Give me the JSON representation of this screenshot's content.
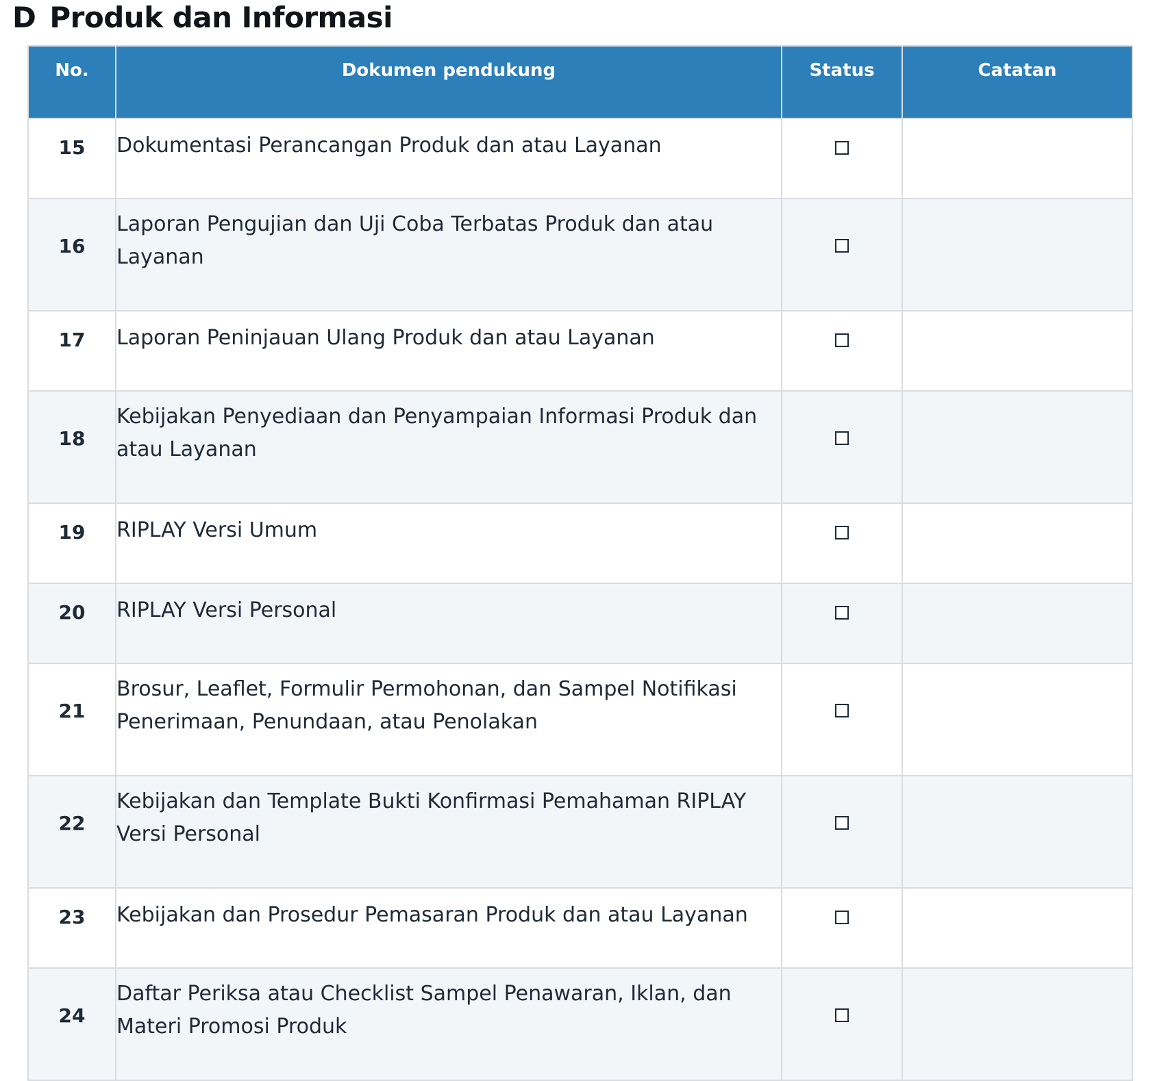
{
  "section": {
    "letter": "D",
    "title": "Produk dan Informasi"
  },
  "table": {
    "headers": {
      "no": "No.",
      "document": "Dokumen pendukung",
      "status": "Status",
      "notes": "Catatan"
    },
    "rows": [
      {
        "no": "15",
        "document": "Dokumentasi Perancangan Produk dan atau Layanan",
        "checked": false,
        "notes": ""
      },
      {
        "no": "16",
        "document": "Laporan Pengujian dan Uji Coba Terbatas Produk dan atau Layanan",
        "checked": false,
        "notes": ""
      },
      {
        "no": "17",
        "document": "Laporan Peninjauan Ulang Produk dan atau Layanan",
        "checked": false,
        "notes": ""
      },
      {
        "no": "18",
        "document": "Kebijakan Penyediaan dan Penyampaian Informasi Produk dan atau Layanan",
        "checked": false,
        "notes": ""
      },
      {
        "no": "19",
        "document": "RIPLAY Versi Umum",
        "checked": false,
        "notes": ""
      },
      {
        "no": "20",
        "document": "RIPLAY Versi Personal",
        "checked": false,
        "notes": ""
      },
      {
        "no": "21",
        "document": "Brosur, Leaflet, Formulir Permohonan, dan Sampel Notifikasi Penerimaan, Penundaan, atau Penolakan",
        "checked": false,
        "notes": ""
      },
      {
        "no": "22",
        "document": "Kebijakan dan Template Bukti Konfirmasi Pemahaman RIPLAY Versi Personal",
        "checked": false,
        "notes": ""
      },
      {
        "no": "23",
        "document": "Kebijakan dan Prosedur Pemasaran Produk dan atau Layanan",
        "checked": false,
        "notes": ""
      },
      {
        "no": "24",
        "document": "Daftar Periksa atau Checklist Sampel Penawaran, Iklan, dan Materi Promosi Produk",
        "checked": false,
        "notes": ""
      }
    ]
  },
  "colors": {
    "header_bg": "#2c7fb8",
    "header_text": "#ffffff",
    "row_alt_bg": "#f2f6f9",
    "border": "#d9dde2"
  }
}
